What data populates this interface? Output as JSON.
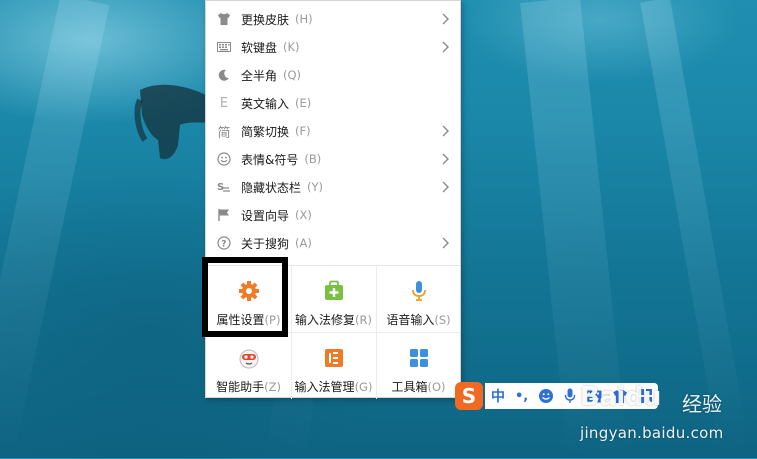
{
  "menu": {
    "items": [
      {
        "icon": "tshirt-icon",
        "label": "更换皮肤",
        "key": "(H)",
        "submenu": true
      },
      {
        "icon": "keyboard-icon",
        "label": "软键盘",
        "key": "(K)",
        "submenu": true
      },
      {
        "icon": "moon-icon",
        "label": "全半角",
        "key": "(Q)",
        "submenu": false
      },
      {
        "icon": "english-e-icon",
        "label": "英文输入",
        "key": "(E)",
        "submenu": false
      },
      {
        "icon": "jian-char-icon",
        "label": "简繁切换",
        "key": "(F)",
        "submenu": true
      },
      {
        "icon": "smiley-icon",
        "label": "表情&符号",
        "key": "(B)",
        "submenu": true
      },
      {
        "icon": "hide-statusbar-icon",
        "label": "隐藏状态栏",
        "key": "(Y)",
        "submenu": true
      },
      {
        "icon": "flag-icon",
        "label": "设置向导",
        "key": "(X)",
        "submenu": false
      },
      {
        "icon": "question-icon",
        "label": "关于搜狗",
        "key": "(A)",
        "submenu": true
      }
    ],
    "grid": [
      {
        "icon": "gear-icon",
        "label": "属性设置",
        "key": "(P)"
      },
      {
        "icon": "repair-bag-icon",
        "label": "输入法修复",
        "key": "(R)"
      },
      {
        "icon": "microphone-icon",
        "label": "语音输入",
        "key": "(S)"
      },
      {
        "icon": "assistant-icon",
        "label": "智能助手",
        "key": "(Z)"
      },
      {
        "icon": "manager-icon",
        "label": "输入法管理",
        "key": "(G)"
      },
      {
        "icon": "toolbox-icon",
        "label": "工具箱",
        "key": "(O)"
      }
    ],
    "jian_glyph": "简",
    "english_glyph": "E"
  },
  "statusbar": {
    "logo": "S",
    "mode": "中",
    "punct": "•,",
    "icons": [
      "smiley-icon",
      "microphone-icon",
      "keyboard-icon",
      "tshirt-icon",
      "grid-icon"
    ]
  },
  "watermark": {
    "brand": "Baidu",
    "suffix": "经验",
    "url": "jingyan.baidu.com"
  },
  "colors": {
    "accent_orange": "#f07a28",
    "accent_green": "#7ac143",
    "accent_blue": "#3d8fe0",
    "highlight_border": "#000000"
  }
}
